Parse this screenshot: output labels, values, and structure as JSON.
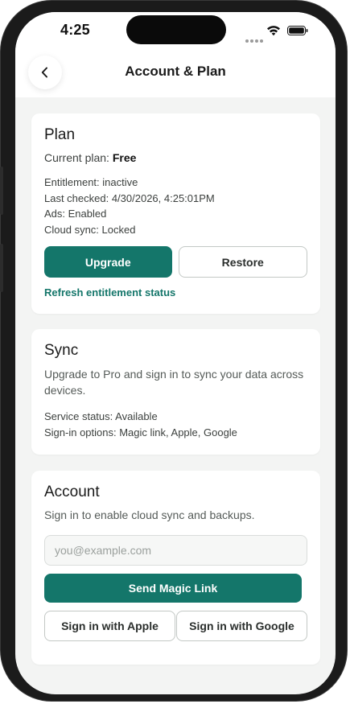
{
  "status_bar": {
    "time": "4:25"
  },
  "header": {
    "title": "Account & Plan",
    "back_icon": "chevron-left-icon"
  },
  "plan": {
    "heading": "Plan",
    "current_plan_label": "Current plan: ",
    "current_plan_value": "Free",
    "entitlement": "Entitlement: inactive",
    "last_checked": "Last checked: 4/30/2026, 4:25:01PM",
    "ads": "Ads: Enabled",
    "cloud_sync": "Cloud sync: Locked",
    "upgrade_label": "Upgrade",
    "restore_label": "Restore",
    "refresh_label": "Refresh entitlement status"
  },
  "sync": {
    "heading": "Sync",
    "description": "Upgrade to Pro and sign in to sync your data across devices.",
    "service_status": "Service status: Available",
    "sign_in_options": "Sign-in options: Magic link, Apple, Google"
  },
  "account": {
    "heading": "Account",
    "description": "Sign in to enable cloud sync and backups.",
    "email_value": "",
    "email_placeholder": "you@example.com",
    "send_magic_link_label": "Send Magic Link",
    "apple_label": "Sign in with Apple",
    "google_label": "Sign in with Google"
  },
  "colors": {
    "primary": "#14766a",
    "background": "#f3f4f3",
    "card": "#ffffff"
  }
}
